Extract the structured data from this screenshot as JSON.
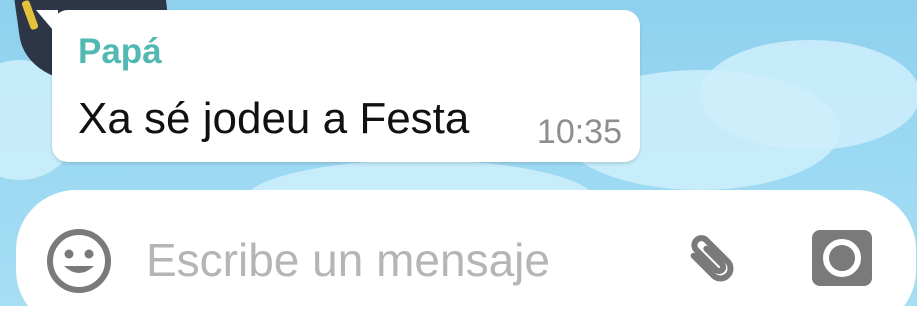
{
  "chat": {
    "message": {
      "sender": "Papá",
      "text": "Xa sé jodeu a Festa",
      "time": "10:35"
    }
  },
  "composer": {
    "placeholder": "Escribe un mensaje",
    "icons": {
      "emoji": "emoji-icon",
      "attach": "paperclip-icon",
      "camera": "camera-icon"
    }
  },
  "colors": {
    "sender_name": "#52b9b2",
    "icon_gray": "#7a7a7a",
    "wallpaper": "#9ad8f2"
  }
}
